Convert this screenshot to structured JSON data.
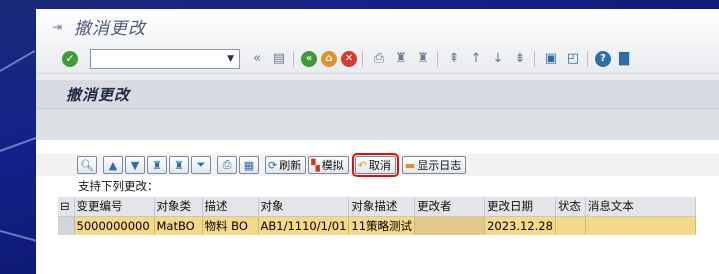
{
  "window": {
    "title": "撤消更改"
  },
  "system_toolbar": {
    "command_field_value": "",
    "icons": [
      "enter-icon",
      "back-icon",
      "exit-icon",
      "cancel-icon",
      "print-icon",
      "find-icon",
      "find-next-icon",
      "first-page-icon",
      "previous-page-icon",
      "next-page-icon",
      "last-page-icon",
      "new-session-icon",
      "shortcut-icon",
      "help-icon",
      "layout-menu-icon"
    ]
  },
  "app": {
    "title": "撤消更改",
    "alv_toolbar": {
      "refresh_label": "刷新",
      "simulate_label": "模拟",
      "cancel_label": "取消",
      "show_log_label": "显示日志"
    },
    "header_text": "支持下列更改：",
    "table": {
      "columns": [
        "变更编号",
        "对象类",
        "描述",
        "对象",
        "对象描述",
        "更改者",
        "更改日期",
        "状态",
        "消息文本"
      ],
      "rows": [
        {
          "change_no": "5000000000",
          "object_class": "MatBO",
          "description": "物料 BO",
          "object": "AB1/1110/1/01",
          "object_description": "11策略测试",
          "changed_by": "",
          "change_date": "2023.12.28",
          "status": "",
          "message_text": ""
        }
      ]
    }
  },
  "colors": {
    "selected_row": "#f5d98a",
    "highlight_box": "#dd1111",
    "background": "#14208a"
  }
}
